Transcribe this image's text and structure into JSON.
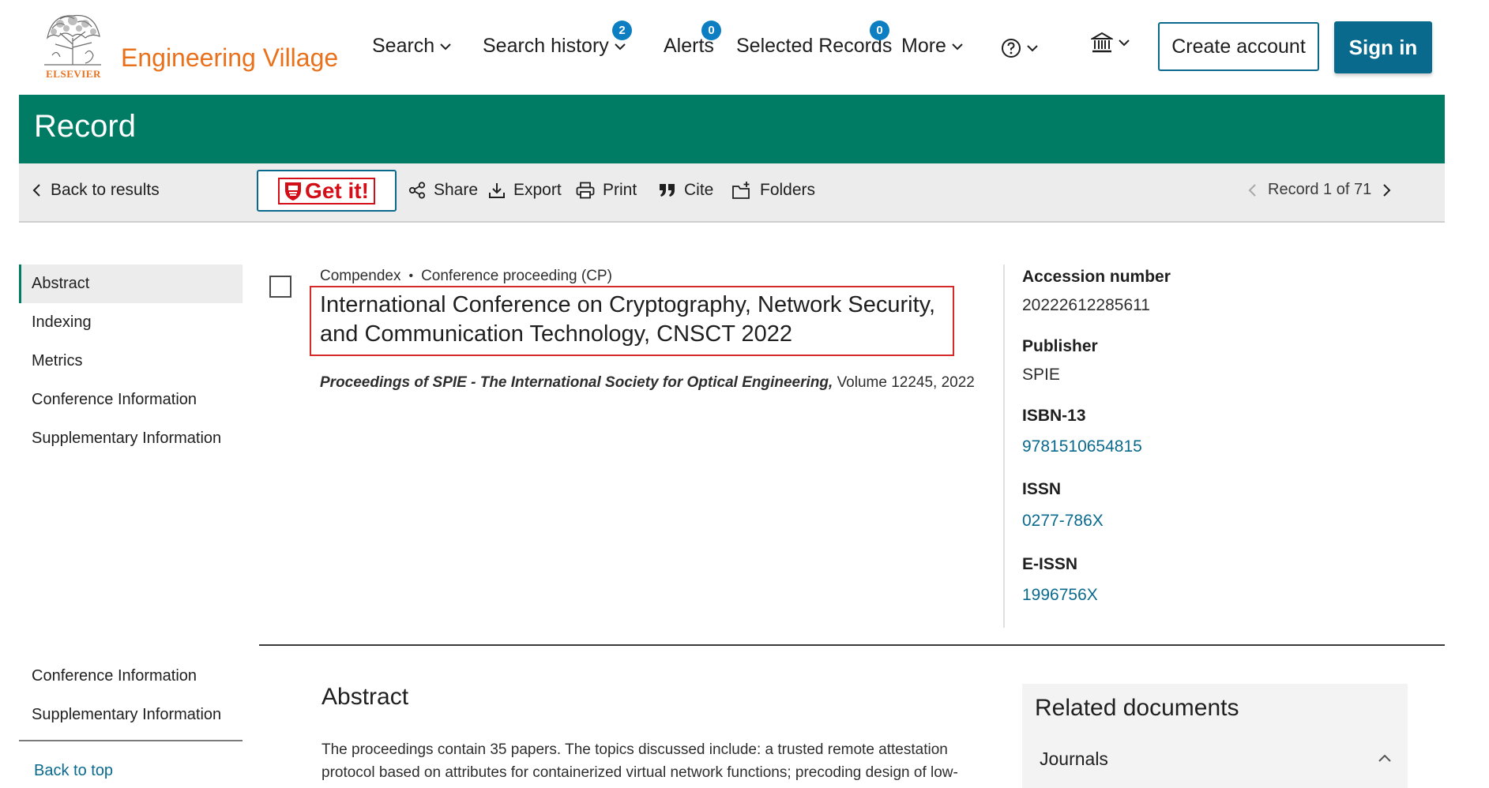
{
  "header": {
    "brand": "Engineering Village",
    "logo_text": "ELSEVIER",
    "nav": [
      {
        "label": "Search"
      },
      {
        "label": "Search history",
        "badge": "2"
      },
      {
        "label": "Alerts",
        "badge": "0"
      },
      {
        "label": "Selected Records",
        "badge": "0"
      },
      {
        "label": "More"
      }
    ],
    "help_icon": "help-circle-icon",
    "institution_icon": "institution-icon",
    "create_account": "Create account",
    "sign_in": "Sign in"
  },
  "banner": {
    "title": "Record"
  },
  "toolbar": {
    "back": "Back to results",
    "getit": "Get it!",
    "share": "Share",
    "export": "Export",
    "print": "Print",
    "cite": "Cite",
    "folders": "Folders",
    "record_position": "Record 1 of 71"
  },
  "sidebar": {
    "items": [
      "Abstract",
      "Indexing",
      "Metrics",
      "Conference Information",
      "Supplementary Information"
    ],
    "lower_items": [
      "Conference Information",
      "Supplementary Information"
    ],
    "back_to_top": "Back to top"
  },
  "record": {
    "database": "Compendex",
    "doc_type": "Conference proceeding (CP)",
    "title": "International Conference on Cryptography, Network Security, and Communication Technology, CNSCT 2022",
    "source_title": "Proceedings of SPIE - The International Society for Optical Engineering,",
    "source_detail": "Volume 12245, 2022"
  },
  "details": {
    "accession_label": "Accession number",
    "accession_value": "20222612285611",
    "publisher_label": "Publisher",
    "publisher_value": "SPIE",
    "isbn_label": "ISBN-13",
    "isbn_value": "9781510654815",
    "issn_label": "ISSN",
    "issn_value": "0277-786X",
    "eissn_label": "E-ISSN",
    "eissn_value": "1996756X"
  },
  "abstract": {
    "heading": "Abstract",
    "text": "The proceedings contain 35 papers. The topics discussed include: a trusted remote attestation protocol based on attributes for containerized virtual network functions; precoding design of low-"
  },
  "related": {
    "title": "Related documents",
    "item": "Journals"
  },
  "colors": {
    "brand_orange": "#e9711c",
    "banner_green": "#007c64",
    "primary_blue": "#0a6a8e",
    "badge_blue": "#0c7ec1",
    "highlight_red": "#d62a2a"
  }
}
